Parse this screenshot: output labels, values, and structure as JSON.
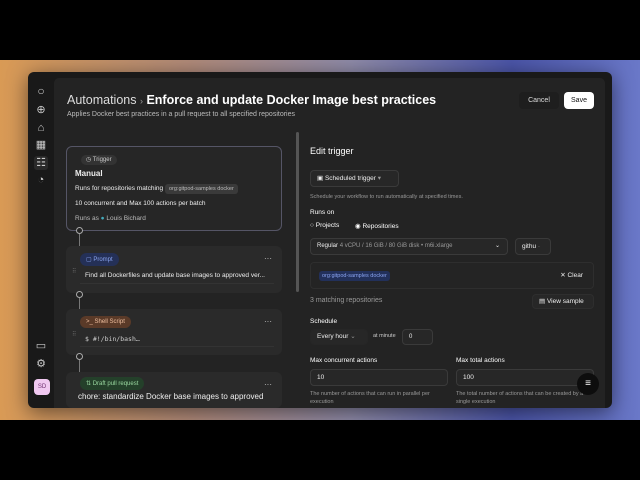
{
  "header": {
    "breadcrumb_root": "Automations",
    "separator": "›",
    "title": "Enforce and update Docker Image best practices",
    "subtitle": "Applies Docker best practices in a pull request to all specified repositories",
    "cancel": "Cancel",
    "save": "Save"
  },
  "sidebar": {
    "avatar": "SD"
  },
  "workflow": {
    "trigger": {
      "tag": "Trigger",
      "title": "Manual",
      "runs_for": "Runs for repositories matching",
      "filter": "org:gitpod-samples docker",
      "limits": "10 concurrent and Max 100 actions per batch",
      "runs_as": "Runs as",
      "user": "Louis Bichard"
    },
    "prompt": {
      "tag": "Prompt",
      "text": "Find all Dockerfiles and update base images to approved ver..."
    },
    "shell": {
      "tag": "Shell Script",
      "text": "$ #!/bin/bash…"
    },
    "pr": {
      "tag": "Draft pull request",
      "text": "chore: standardize Docker base images to approved"
    },
    "menu": "···"
  },
  "edit": {
    "title": "Edit trigger",
    "trigger_type": "Scheduled trigger",
    "trigger_help": "Schedule your workflow to run automatically at specified times.",
    "runs_on": "Runs on",
    "opt_projects": "Projects",
    "opt_repos": "Repositories",
    "class_name": "Regular",
    "class_spec": "4 vCPU / 16 GiB / 80 GiB disk • m6i.xlarge",
    "provider": "githu",
    "filter_chip": "org:gitpod-samples docker",
    "clear": "Clear",
    "matching": "3 matching repositories",
    "view_sample": "View sample",
    "schedule": "Schedule",
    "frequency": "Every hour",
    "at_minute": "at minute",
    "minute": "0",
    "max_conc_label": "Max concurrent actions",
    "max_conc": "10",
    "max_conc_help": "The number of actions that can run in parallel per execution",
    "max_total_label": "Max total actions",
    "max_total": "100",
    "max_total_help": "The total number of actions that can be created by a single execution"
  }
}
